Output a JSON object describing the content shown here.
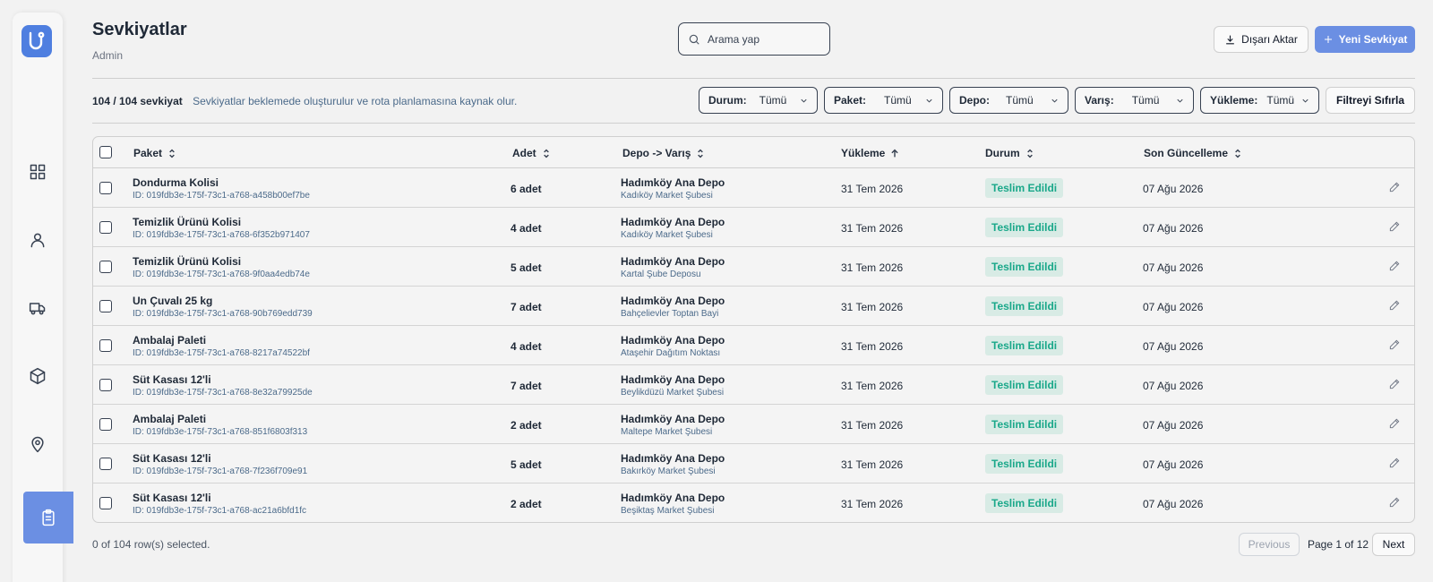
{
  "page": {
    "title": "Sevkiyatlar",
    "subtitle": "Admin"
  },
  "search": {
    "placeholder": "Arama yap"
  },
  "actions": {
    "export_label": "Dışarı Aktar",
    "new_label": "Yeni Sevkiyat"
  },
  "summary": {
    "count": "104 / 104 sevkiyat",
    "description": "Sevkiyatlar beklemede oluşturulur ve rota planlamasına kaynak olur."
  },
  "filters": [
    {
      "label": "Durum:",
      "value": "Tümü"
    },
    {
      "label": "Paket:",
      "value": "Tümü"
    },
    {
      "label": "Depo:",
      "value": "Tümü"
    },
    {
      "label": "Varış:",
      "value": "Tümü"
    },
    {
      "label": "Yükleme:",
      "value": "Tümü"
    }
  ],
  "reset_label": "Filtreyi Sıfırla",
  "table": {
    "columns": [
      "Paket",
      "Adet",
      "Depo -> Varış",
      "Yükleme",
      "Durum",
      "Son Güncelleme"
    ],
    "rows": [
      {
        "name": "Dondurma Kolisi",
        "id": "ID: 019fdb3e-175f-73c1-a768-a458b00ef7be",
        "qty": "6 adet",
        "depot": "Hadımköy Ana Depo",
        "dest": "Kadıköy Market Şubesi",
        "load": "31 Tem 2026",
        "status": "Teslim Edildi",
        "updated": "07 Ağu 2026"
      },
      {
        "name": "Temizlik Ürünü Kolisi",
        "id": "ID: 019fdb3e-175f-73c1-a768-6f352b971407",
        "qty": "4 adet",
        "depot": "Hadımköy Ana Depo",
        "dest": "Kadıköy Market Şubesi",
        "load": "31 Tem 2026",
        "status": "Teslim Edildi",
        "updated": "07 Ağu 2026"
      },
      {
        "name": "Temizlik Ürünü Kolisi",
        "id": "ID: 019fdb3e-175f-73c1-a768-9f0aa4edb74e",
        "qty": "5 adet",
        "depot": "Hadımköy Ana Depo",
        "dest": "Kartal Şube Deposu",
        "load": "31 Tem 2026",
        "status": "Teslim Edildi",
        "updated": "07 Ağu 2026"
      },
      {
        "name": "Un Çuvalı 25 kg",
        "id": "ID: 019fdb3e-175f-73c1-a768-90b769edd739",
        "qty": "7 adet",
        "depot": "Hadımköy Ana Depo",
        "dest": "Bahçelievler Toptan Bayi",
        "load": "31 Tem 2026",
        "status": "Teslim Edildi",
        "updated": "07 Ağu 2026"
      },
      {
        "name": "Ambalaj Paleti",
        "id": "ID: 019fdb3e-175f-73c1-a768-8217a74522bf",
        "qty": "4 adet",
        "depot": "Hadımköy Ana Depo",
        "dest": "Ataşehir Dağıtım Noktası",
        "load": "31 Tem 2026",
        "status": "Teslim Edildi",
        "updated": "07 Ağu 2026"
      },
      {
        "name": "Süt Kasası 12'li",
        "id": "ID: 019fdb3e-175f-73c1-a768-8e32a79925de",
        "qty": "7 adet",
        "depot": "Hadımköy Ana Depo",
        "dest": "Beylikdüzü Market Şubesi",
        "load": "31 Tem 2026",
        "status": "Teslim Edildi",
        "updated": "07 Ağu 2026"
      },
      {
        "name": "Ambalaj Paleti",
        "id": "ID: 019fdb3e-175f-73c1-a768-851f6803f313",
        "qty": "2 adet",
        "depot": "Hadımköy Ana Depo",
        "dest": "Maltepe Market Şubesi",
        "load": "31 Tem 2026",
        "status": "Teslim Edildi",
        "updated": "07 Ağu 2026"
      },
      {
        "name": "Süt Kasası 12'li",
        "id": "ID: 019fdb3e-175f-73c1-a768-7f236f709e91",
        "qty": "5 adet",
        "depot": "Hadımköy Ana Depo",
        "dest": "Bakırköy Market Şubesi",
        "load": "31 Tem 2026",
        "status": "Teslim Edildi",
        "updated": "07 Ağu 2026"
      },
      {
        "name": "Süt Kasası 12'li",
        "id": "ID: 019fdb3e-175f-73c1-a768-ac21a6bfd1fc",
        "qty": "2 adet",
        "depot": "Hadımköy Ana Depo",
        "dest": "Beşiktaş Market Şubesi",
        "load": "31 Tem 2026",
        "status": "Teslim Edildi",
        "updated": "07 Ağu 2026"
      }
    ]
  },
  "footer": {
    "selected": "0 of 104 row(s) selected.",
    "previous": "Previous",
    "page_info": "Page 1 of 12",
    "next": "Next"
  },
  "colors": {
    "accent": "#6b8fe3",
    "status_bg": "#d8ebe5",
    "status_text": "#1aa88a"
  },
  "icons": [
    "dashboard-icon",
    "user-icon",
    "truck-icon",
    "package-icon",
    "map-pin-icon",
    "clipboard-icon"
  ]
}
